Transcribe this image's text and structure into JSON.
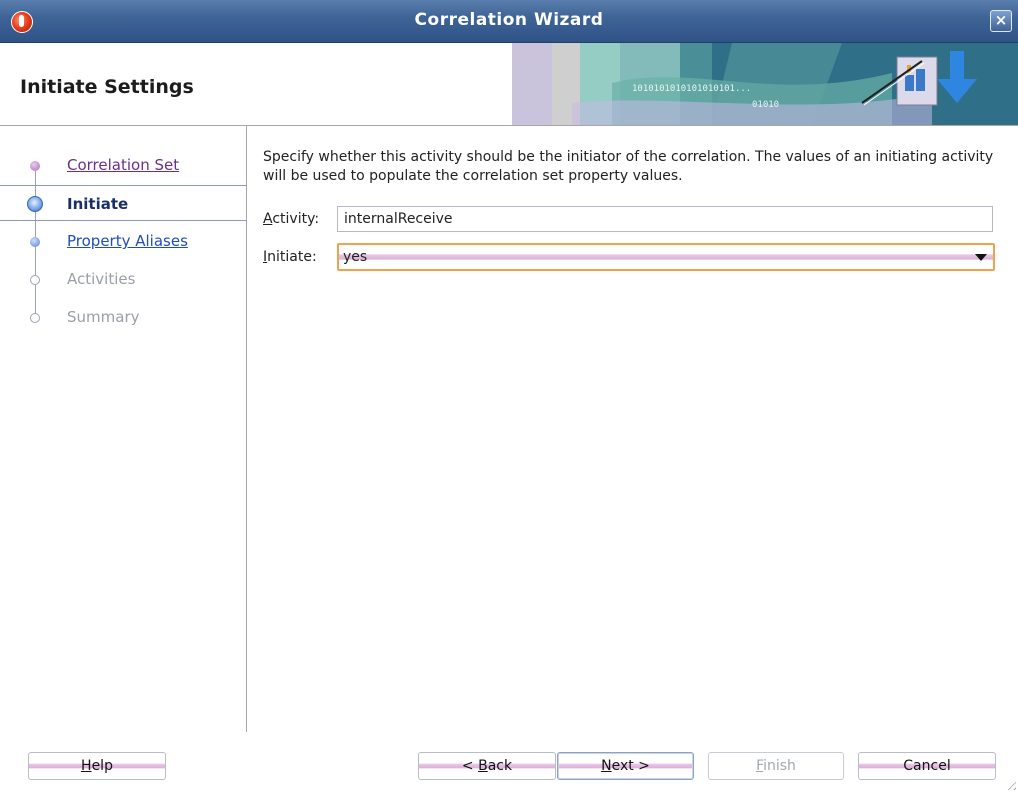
{
  "window": {
    "title": "Correlation Wizard",
    "close_symbol": "×"
  },
  "header": {
    "title": "Initiate Settings",
    "graphic_icon": "wizard-banner-graphic"
  },
  "nav": {
    "items": [
      {
        "label": "Correlation Set",
        "state": "visited"
      },
      {
        "label": "Initiate",
        "state": "current"
      },
      {
        "label": "Property Aliases",
        "state": "available"
      },
      {
        "label": "Activities",
        "state": "disabled"
      },
      {
        "label": "Summary",
        "state": "disabled"
      }
    ]
  },
  "content": {
    "description": "Specify whether this activity should be the initiator of the correlation. The values of an initiating activity will be used to populate the correlation set property values.",
    "activity": {
      "mnemonic": "A",
      "label_rest": "ctivity:",
      "value": "internalReceive"
    },
    "initiate": {
      "mnemonic": "I",
      "label_rest": "nitiate:",
      "value": "yes"
    }
  },
  "buttons": {
    "help": {
      "mnemonic": "H",
      "rest": "elp"
    },
    "back": {
      "prefix": "< ",
      "mnemonic": "B",
      "rest": "ack"
    },
    "next": {
      "mnemonic": "N",
      "rest": "ext >"
    },
    "finish": {
      "mnemonic": "F",
      "rest": "inish"
    },
    "cancel": "Cancel"
  },
  "colors": {
    "titlebar": "#3f6496",
    "focus_border": "#f2a24a",
    "link_visited": "#6a2f8a",
    "link_available": "#1f4cc0"
  }
}
